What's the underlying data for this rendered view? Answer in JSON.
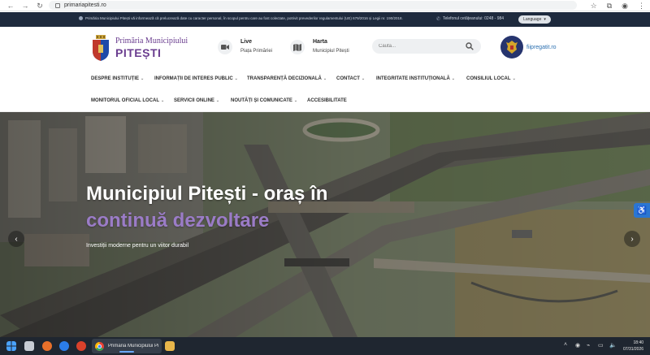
{
  "browser": {
    "url": "primariapitesti.ro"
  },
  "infobar": {
    "cookie_text": "Primăria Municipiului Pitești vă informează că prelucrează date cu caracter personal, în scopul pentru care au fost colectate, potrivit prevederilor regulamentului (UE) 679/2016 și Legii nr. 190/2018.",
    "phone_text": "Telefonul cetățeanului: 0248 - 984",
    "language_label": "Language"
  },
  "header": {
    "brand_top": "Primăria Municipiului",
    "brand_main": "PITEȘTI",
    "live_title": "Live",
    "live_sub": "Piața Primăriei",
    "map_title": "Harta",
    "map_sub": "Municipiul Pitești",
    "search_placeholder": "Caută...",
    "gov_link": "fiipregatit.ro"
  },
  "menu": {
    "items": [
      "DESPRE INSTITUȚIE",
      "INFORMAȚII DE INTERES PUBLIC",
      "TRANSPARENȚĂ DECIZIONALĂ",
      "CONTACT",
      "INTEGRITATE INSTITUȚIONALĂ",
      "CONSILIUL LOCAL",
      "MONITORUL OFICIAL LOCAL",
      "SERVICII ONLINE",
      "NOUTĂȚI ȘI COMUNICATE",
      "ACCESIBILITATE"
    ]
  },
  "hero": {
    "title_line1": "Municipiul Pitești - oraș în",
    "title_line2": "continuă dezvoltare",
    "subtitle": "Investiții moderne pentru un viitor durabil"
  },
  "taskbar": {
    "active_app": "Primăria Municipiului Pi",
    "time": "18:40",
    "date": "07/31/2026"
  },
  "colors": {
    "brand_purple": "#6a3d8f",
    "info_bar": "#1e2a3d",
    "accent_lilac": "#9b7cc7",
    "accessibility_blue": "#2a76d2"
  }
}
